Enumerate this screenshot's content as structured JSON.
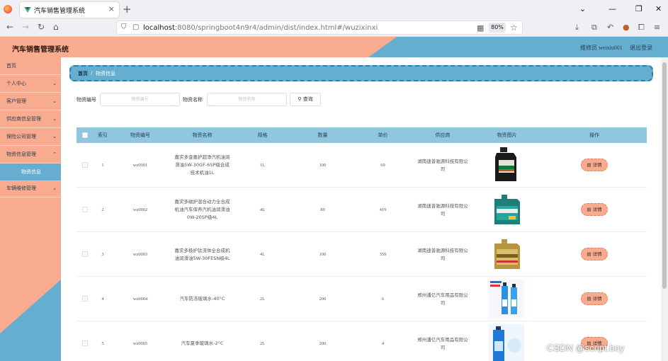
{
  "browser": {
    "tab_title": "汽车销售管理系统",
    "url_host": "localhost",
    "url_rest": ":8080/springboot4n9r4/admin/dist/index.html#/wuzixinxi",
    "zoom": "80%"
  },
  "header": {
    "title": "汽车销售管理系统",
    "user": "维修员 weixiu001",
    "logout": "退出登录"
  },
  "sidebar": {
    "items": [
      {
        "label": "首页",
        "arrow": ""
      },
      {
        "label": "个人中心",
        "arrow": "⌄"
      },
      {
        "label": "客户管理",
        "arrow": "⌄"
      },
      {
        "label": "供应商信息管理",
        "arrow": "⌄"
      },
      {
        "label": "保险公司管理",
        "arrow": "⌄"
      },
      {
        "label": "物资信息管理",
        "arrow": "⌃"
      },
      {
        "label": "物资信息",
        "arrow": ""
      },
      {
        "label": "车辆维修管理",
        "arrow": "⌄"
      }
    ]
  },
  "breadcrumb": {
    "home": "首页",
    "sep": "/",
    "current": "物资信息"
  },
  "filters": {
    "code_label": "物资编号",
    "code_placeholder": "物资编号",
    "name_label": "物资名称",
    "name_placeholder": "物资名称",
    "search_label": "查询"
  },
  "table": {
    "headers": [
      "索引",
      "物资编号",
      "物资名称",
      "规格",
      "数量",
      "单价",
      "供应商",
      "物资图片",
      "操作"
    ],
    "detail_label": "详情",
    "rows": [
      {
        "index": "1",
        "code": "wz0001",
        "name": "嘉实多金嘉护超净汽机油润滑油5W-30GF-6SP级合成技术机油1L",
        "spec": "1L",
        "qty": "100",
        "price": "69",
        "supplier": "湖南速普驰源科技有限公司",
        "image": "black-oil-bottle"
      },
      {
        "index": "2",
        "code": "wz0002",
        "name": "嘉实多磁护混合动力全合成机油汽车保养汽机油润滑油0W-20SP级4L",
        "spec": "4L",
        "qty": "89",
        "price": "419",
        "supplier": "湖南速普驰源科技有限公司",
        "image": "teal-oil-jug"
      },
      {
        "index": "3",
        "code": "wz0003",
        "name": "嘉实多极护钛流体全合成机油润滑油5W-30FESN级4L",
        "spec": "4L",
        "qty": "100",
        "price": "359",
        "supplier": "湖南速普驰源科技有限公司",
        "image": "gold-oil-jug"
      },
      {
        "index": "4",
        "code": "wz0004",
        "name": "汽车防冻玻璃水-40°C",
        "spec": "2L",
        "qty": "200",
        "price": "6",
        "supplier": "郑州潘亿汽车用品有限公司",
        "image": "blue-washer-bottles"
      },
      {
        "index": "5",
        "code": "wz0005",
        "name": "汽车夏季玻璃水-2°C",
        "spec": "2L",
        "qty": "200",
        "price": "4",
        "supplier": "郑州潘亿汽车用品有限公司",
        "image": "blue-washer-bottle"
      }
    ]
  },
  "watermark": "CSDN @script.boy",
  "colors": {
    "salmon": "#f8ab8e",
    "blue": "#65aed0",
    "table_header": "#8fc7e1"
  }
}
